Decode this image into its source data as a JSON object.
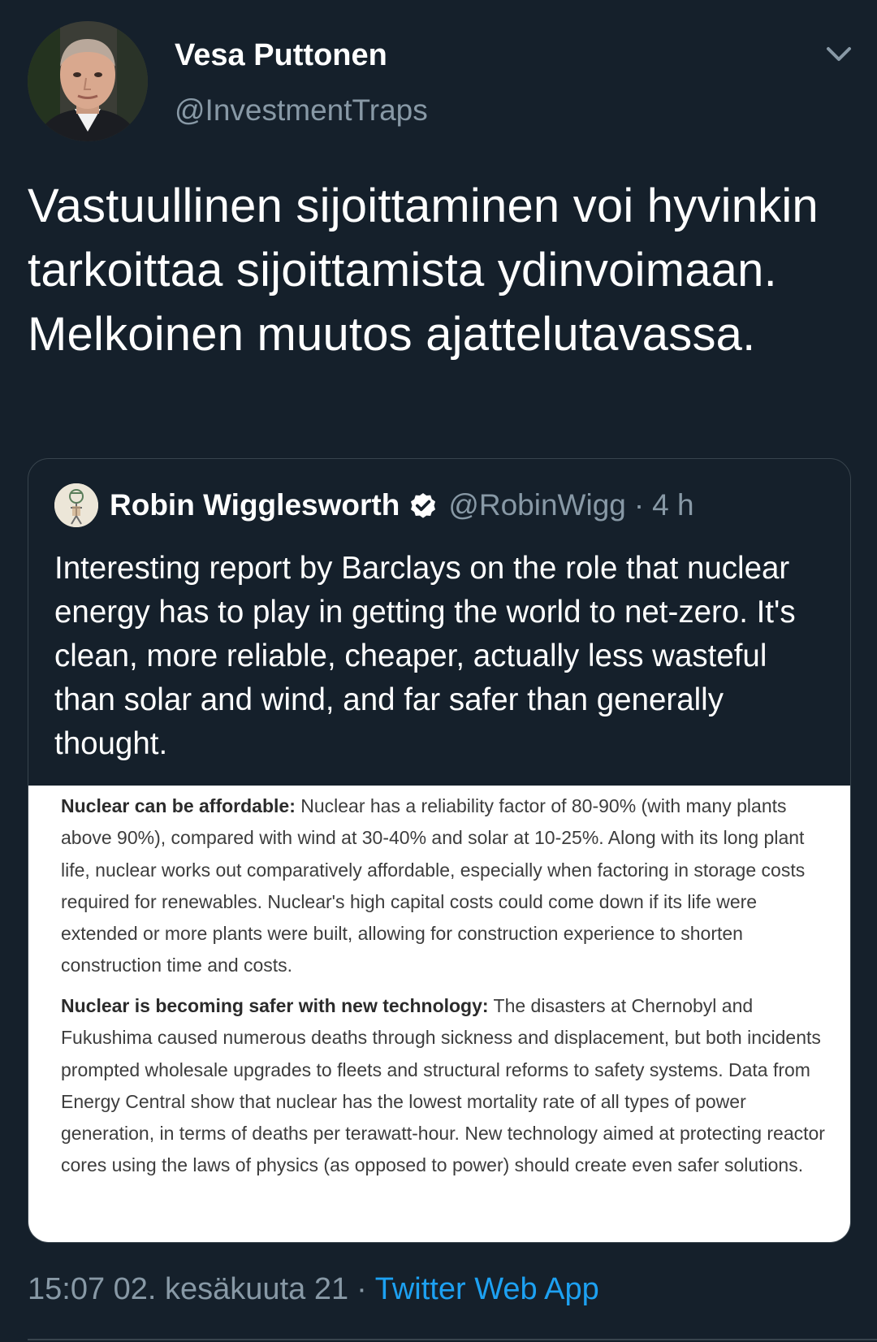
{
  "author": {
    "name": "Vesa Puttonen",
    "handle": "@InvestmentTraps",
    "avatar_icon": "person-portrait-icon"
  },
  "tweet": {
    "text": "Vastuullinen sijoittaminen voi hyvinkin tarkoittaa sijoittamista ydinvoimaan. Melkoinen muutos ajattelutavassa."
  },
  "quoted_tweet": {
    "name": "Robin Wigglesworth",
    "verified_icon": "verified-badge-icon",
    "handle": "@RobinWigg",
    "separator": "·",
    "time": "4 h",
    "text": "Interesting report by Barclays on the role that nuclear energy has to play in getting the world to net-zero. It's clean, more reliable, cheaper, actually less wasteful than solar and wind, and far safer than generally thought.",
    "image": {
      "paragraphs": [
        {
          "heading": "Nuclear can be affordable:",
          "body": " Nuclear has a reliability factor of 80-90% (with many plants above 90%), compared with wind at 30-40% and solar at 10-25%. Along with its long plant life, nuclear works out comparatively affordable, especially when factoring in storage costs required for renewables. Nuclear's high capital costs could come down if its life were extended or more plants were built, allowing for construction experience to shorten construction time and costs."
        },
        {
          "heading": "Nuclear is becoming safer with new technology:",
          "body": " The disasters at Chernobyl and Fukushima caused numerous deaths through sickness and displacement, but both incidents prompted wholesale upgrades to fleets and structural reforms to safety systems. Data from Energy Central show that nuclear has the lowest mortality rate of all types of power generation, in terms of deaths per terawatt-hour. New technology aimed at protecting reactor cores using the laws of physics (as opposed to power) should create even safer solutions."
        }
      ]
    }
  },
  "footer": {
    "timestamp": "15:07 02. kesäkuuta 21",
    "separator": "·",
    "source": "Twitter Web App"
  },
  "colors": {
    "background": "#15202b",
    "secondary_text": "#8899a6",
    "link": "#1da1f2",
    "border": "#38444d"
  }
}
